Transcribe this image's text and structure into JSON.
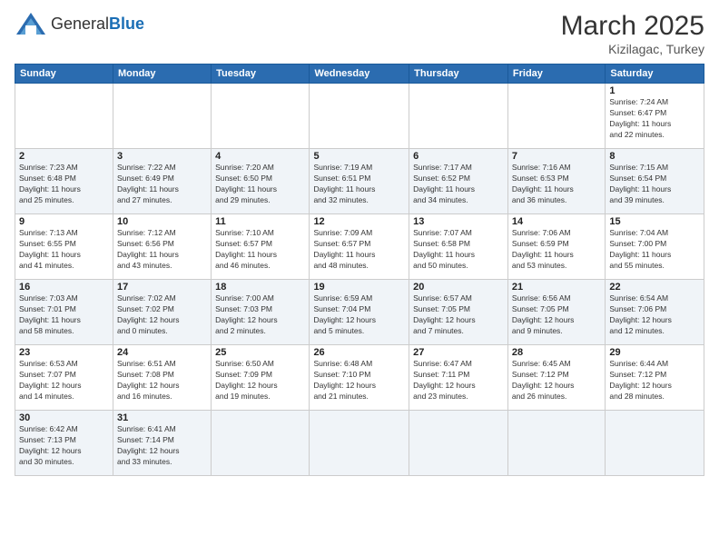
{
  "header": {
    "logo_general": "General",
    "logo_blue": "Blue",
    "month_title": "March 2025",
    "location": "Kizilagac, Turkey"
  },
  "days_of_week": [
    "Sunday",
    "Monday",
    "Tuesday",
    "Wednesday",
    "Thursday",
    "Friday",
    "Saturday"
  ],
  "weeks": [
    {
      "days": [
        {
          "num": "",
          "info": ""
        },
        {
          "num": "",
          "info": ""
        },
        {
          "num": "",
          "info": ""
        },
        {
          "num": "",
          "info": ""
        },
        {
          "num": "",
          "info": ""
        },
        {
          "num": "",
          "info": ""
        },
        {
          "num": "1",
          "info": "Sunrise: 7:24 AM\nSunset: 6:47 PM\nDaylight: 11 hours\nand 22 minutes."
        }
      ]
    },
    {
      "days": [
        {
          "num": "2",
          "info": "Sunrise: 7:23 AM\nSunset: 6:48 PM\nDaylight: 11 hours\nand 25 minutes."
        },
        {
          "num": "3",
          "info": "Sunrise: 7:22 AM\nSunset: 6:49 PM\nDaylight: 11 hours\nand 27 minutes."
        },
        {
          "num": "4",
          "info": "Sunrise: 7:20 AM\nSunset: 6:50 PM\nDaylight: 11 hours\nand 29 minutes."
        },
        {
          "num": "5",
          "info": "Sunrise: 7:19 AM\nSunset: 6:51 PM\nDaylight: 11 hours\nand 32 minutes."
        },
        {
          "num": "6",
          "info": "Sunrise: 7:17 AM\nSunset: 6:52 PM\nDaylight: 11 hours\nand 34 minutes."
        },
        {
          "num": "7",
          "info": "Sunrise: 7:16 AM\nSunset: 6:53 PM\nDaylight: 11 hours\nand 36 minutes."
        },
        {
          "num": "8",
          "info": "Sunrise: 7:15 AM\nSunset: 6:54 PM\nDaylight: 11 hours\nand 39 minutes."
        }
      ]
    },
    {
      "days": [
        {
          "num": "9",
          "info": "Sunrise: 7:13 AM\nSunset: 6:55 PM\nDaylight: 11 hours\nand 41 minutes."
        },
        {
          "num": "10",
          "info": "Sunrise: 7:12 AM\nSunset: 6:56 PM\nDaylight: 11 hours\nand 43 minutes."
        },
        {
          "num": "11",
          "info": "Sunrise: 7:10 AM\nSunset: 6:57 PM\nDaylight: 11 hours\nand 46 minutes."
        },
        {
          "num": "12",
          "info": "Sunrise: 7:09 AM\nSunset: 6:57 PM\nDaylight: 11 hours\nand 48 minutes."
        },
        {
          "num": "13",
          "info": "Sunrise: 7:07 AM\nSunset: 6:58 PM\nDaylight: 11 hours\nand 50 minutes."
        },
        {
          "num": "14",
          "info": "Sunrise: 7:06 AM\nSunset: 6:59 PM\nDaylight: 11 hours\nand 53 minutes."
        },
        {
          "num": "15",
          "info": "Sunrise: 7:04 AM\nSunset: 7:00 PM\nDaylight: 11 hours\nand 55 minutes."
        }
      ]
    },
    {
      "days": [
        {
          "num": "16",
          "info": "Sunrise: 7:03 AM\nSunset: 7:01 PM\nDaylight: 11 hours\nand 58 minutes."
        },
        {
          "num": "17",
          "info": "Sunrise: 7:02 AM\nSunset: 7:02 PM\nDaylight: 12 hours\nand 0 minutes."
        },
        {
          "num": "18",
          "info": "Sunrise: 7:00 AM\nSunset: 7:03 PM\nDaylight: 12 hours\nand 2 minutes."
        },
        {
          "num": "19",
          "info": "Sunrise: 6:59 AM\nSunset: 7:04 PM\nDaylight: 12 hours\nand 5 minutes."
        },
        {
          "num": "20",
          "info": "Sunrise: 6:57 AM\nSunset: 7:05 PM\nDaylight: 12 hours\nand 7 minutes."
        },
        {
          "num": "21",
          "info": "Sunrise: 6:56 AM\nSunset: 7:05 PM\nDaylight: 12 hours\nand 9 minutes."
        },
        {
          "num": "22",
          "info": "Sunrise: 6:54 AM\nSunset: 7:06 PM\nDaylight: 12 hours\nand 12 minutes."
        }
      ]
    },
    {
      "days": [
        {
          "num": "23",
          "info": "Sunrise: 6:53 AM\nSunset: 7:07 PM\nDaylight: 12 hours\nand 14 minutes."
        },
        {
          "num": "24",
          "info": "Sunrise: 6:51 AM\nSunset: 7:08 PM\nDaylight: 12 hours\nand 16 minutes."
        },
        {
          "num": "25",
          "info": "Sunrise: 6:50 AM\nSunset: 7:09 PM\nDaylight: 12 hours\nand 19 minutes."
        },
        {
          "num": "26",
          "info": "Sunrise: 6:48 AM\nSunset: 7:10 PM\nDaylight: 12 hours\nand 21 minutes."
        },
        {
          "num": "27",
          "info": "Sunrise: 6:47 AM\nSunset: 7:11 PM\nDaylight: 12 hours\nand 23 minutes."
        },
        {
          "num": "28",
          "info": "Sunrise: 6:45 AM\nSunset: 7:12 PM\nDaylight: 12 hours\nand 26 minutes."
        },
        {
          "num": "29",
          "info": "Sunrise: 6:44 AM\nSunset: 7:12 PM\nDaylight: 12 hours\nand 28 minutes."
        }
      ]
    },
    {
      "days": [
        {
          "num": "30",
          "info": "Sunrise: 6:42 AM\nSunset: 7:13 PM\nDaylight: 12 hours\nand 30 minutes."
        },
        {
          "num": "31",
          "info": "Sunrise: 6:41 AM\nSunset: 7:14 PM\nDaylight: 12 hours\nand 33 minutes."
        },
        {
          "num": "",
          "info": ""
        },
        {
          "num": "",
          "info": ""
        },
        {
          "num": "",
          "info": ""
        },
        {
          "num": "",
          "info": ""
        },
        {
          "num": "",
          "info": ""
        }
      ]
    }
  ]
}
